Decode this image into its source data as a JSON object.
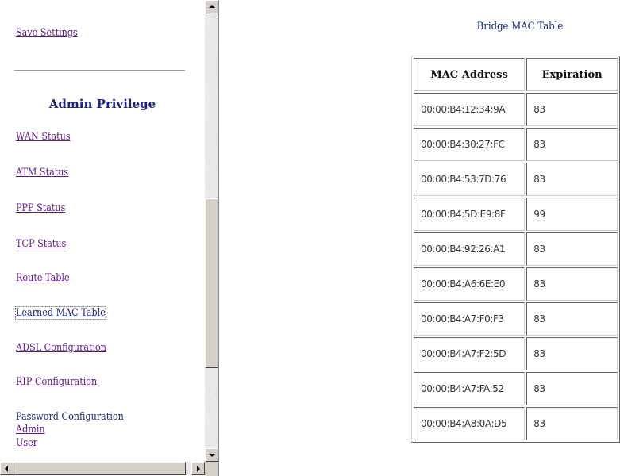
{
  "sidebar": {
    "save_settings": "Save Settings",
    "admin_heading": "Admin Privilege",
    "links": {
      "wan_status": "WAN Status",
      "atm_status": "ATM Status",
      "ppp_status": "PPP Status",
      "tcp_status": "TCP Status",
      "route_table": "Route Table",
      "learned_mac_table": "Learned MAC Table",
      "adsl_configuration": "ADSL Configuration",
      "rip_configuration": "RIP Configuration"
    },
    "password_configuration": {
      "heading": "Password Configuration",
      "admin": "Admin",
      "user": "User"
    }
  },
  "main": {
    "title": "Bridge MAC Table",
    "table": {
      "headers": [
        "MAC Address",
        "Expiration"
      ],
      "rows": [
        {
          "mac": "00:00:B4:12:34:9A",
          "expiration": "83"
        },
        {
          "mac": "00:00:B4:30:27:FC",
          "expiration": "83"
        },
        {
          "mac": "00:00:B4:53:7D:76",
          "expiration": "83"
        },
        {
          "mac": "00:00:B4:5D:E9:8F",
          "expiration": "99"
        },
        {
          "mac": "00:00:B4:92:26:A1",
          "expiration": "83"
        },
        {
          "mac": "00:00:B4:A6:6E:E0",
          "expiration": "83"
        },
        {
          "mac": "00:00:B4:A7:F0:F3",
          "expiration": "83"
        },
        {
          "mac": "00:00:B4:A7:F2:5D",
          "expiration": "83"
        },
        {
          "mac": "00:00:B4:A7:FA:52",
          "expiration": "83"
        },
        {
          "mac": "00:00:B4:A8:0A:D5",
          "expiration": "83"
        }
      ]
    }
  },
  "colors": {
    "link": "#5a1a86",
    "heading": "#1a237e",
    "scrollbar_face": "#d4d0c8"
  },
  "icons": {
    "scroll_up": "triangle-up-icon",
    "scroll_down": "triangle-down-icon",
    "scroll_left": "triangle-left-icon",
    "scroll_right": "triangle-right-icon"
  }
}
